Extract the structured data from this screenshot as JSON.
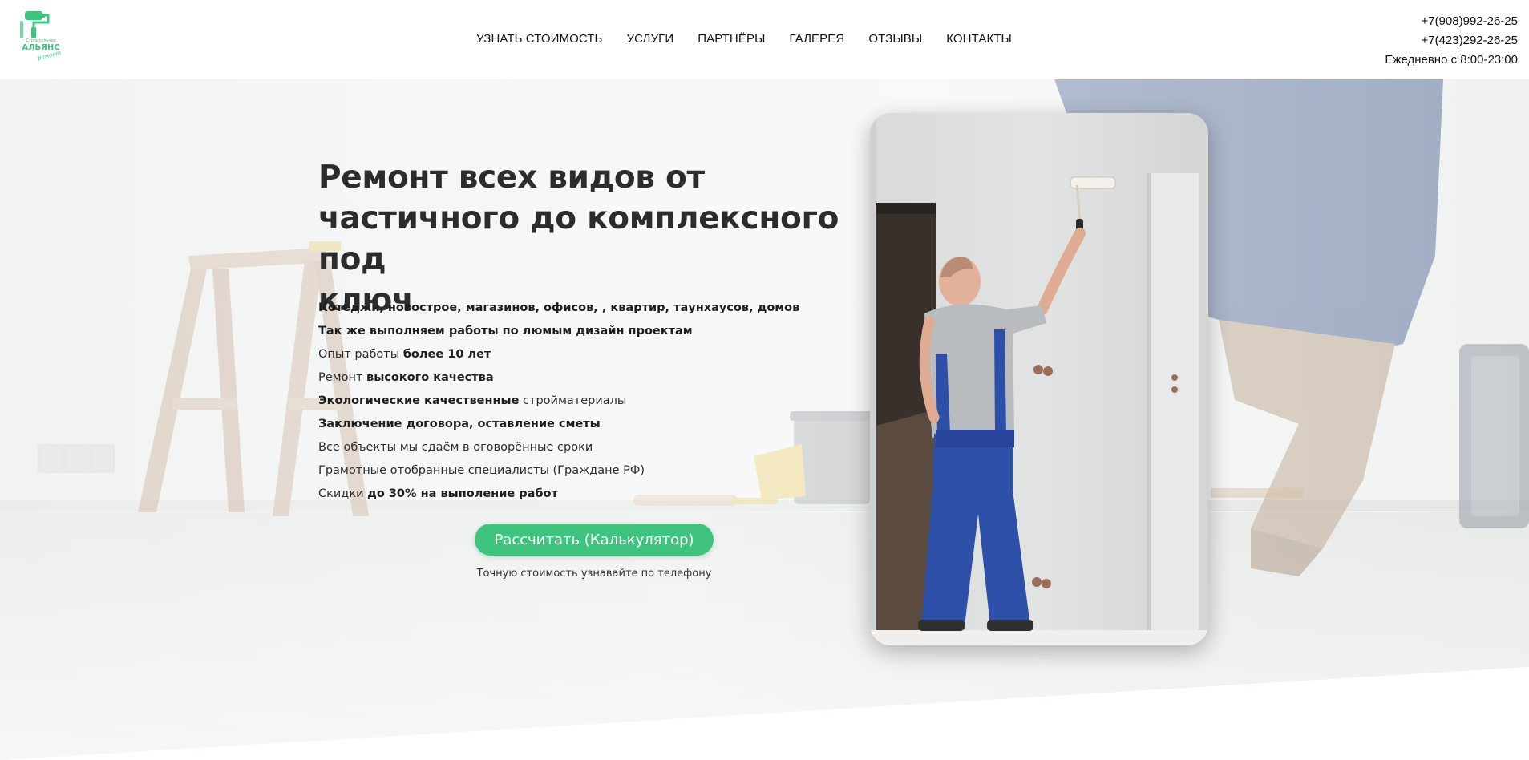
{
  "logo": {
    "brand_top": "Строительная",
    "brand_name": "АЛЬЯНС",
    "brand_bottom": "ремонт",
    "icon": "paint-roller-logo",
    "color": "#3fc47f"
  },
  "nav": {
    "items": [
      {
        "label": "УЗНАТЬ СТОИМОСТЬ"
      },
      {
        "label": "УСЛУГИ"
      },
      {
        "label": "ПАРТНЁРЫ"
      },
      {
        "label": "ГАЛЕРЕЯ"
      },
      {
        "label": "ОТЗЫВЫ"
      },
      {
        "label": "КОНТАКТЫ"
      }
    ]
  },
  "contacts": {
    "phone1": "+7(908)992-26-25",
    "phone2": "+7(423)292-26-25",
    "hours": "Ежедневно с 8:00-23:00"
  },
  "hero": {
    "title_line1": "Ремонт всех видов от",
    "title_line2": "частичного до комплексного под",
    "title_line3": "ключ",
    "features": [
      {
        "pre": "",
        "bold": "Котеджи, новострое, магазинов, офисов, , квартир, таунхаусов, домов",
        "post": ""
      },
      {
        "pre": "",
        "bold": "Так же выполняем работы по люмым дизайн проектам",
        "post": ""
      },
      {
        "pre": "Опыт работы ",
        "bold": "более 10 лет",
        "post": ""
      },
      {
        "pre": "Ремонт ",
        "bold": "высокого качества",
        "post": ""
      },
      {
        "pre": "",
        "bold": "Экологические качественные",
        "post": " стройматериалы"
      },
      {
        "pre": "",
        "bold": "Заключение договора, оставление сметы",
        "post": ""
      },
      {
        "pre": "Все объекты мы сдаём в оговорённые сроки",
        "bold": "",
        "post": ""
      },
      {
        "pre": "Грамотные отобранные специалисты (Граждане РФ)",
        "bold": "",
        "post": ""
      },
      {
        "pre": "Скидки ",
        "bold": "до 30% на выполение работ",
        "post": ""
      }
    ],
    "button_label": "Рассчитать (Калькулятор)",
    "note": "Точную стоимость узнавайте по телефону",
    "accent_color": "#3fc47f"
  }
}
